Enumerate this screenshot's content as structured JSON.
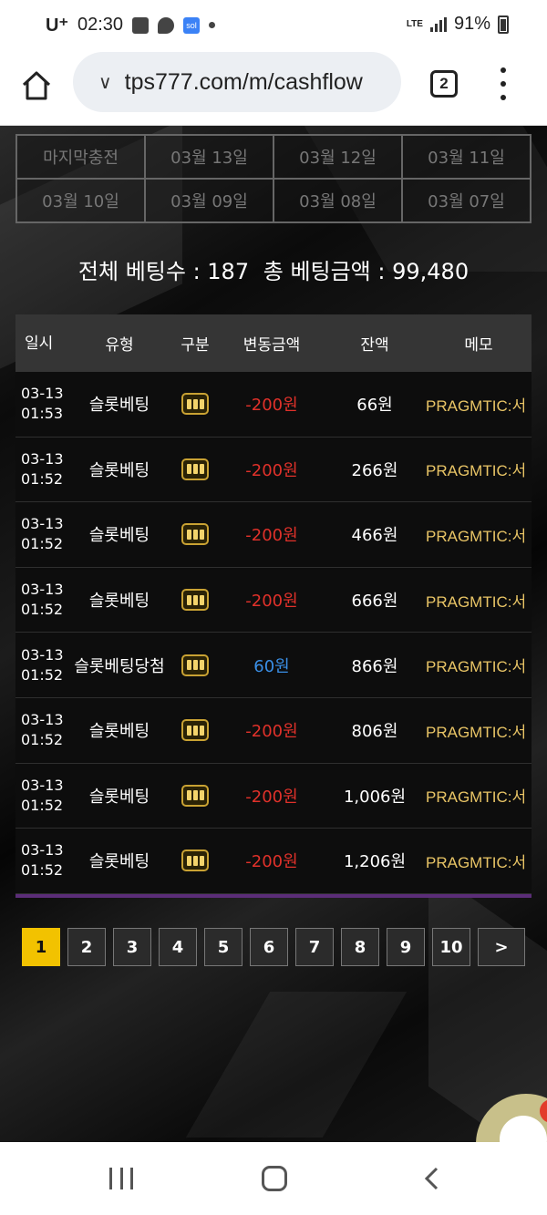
{
  "status_bar": {
    "carrier": "U⁺",
    "time": "02:30",
    "network": "LTE",
    "battery": "91%"
  },
  "browser": {
    "url": "tps777.com/m/cashflow",
    "tab_count": "2",
    "icons": [
      "home-icon",
      "chevron-down-icon",
      "tabs-icon",
      "more-vert-icon"
    ]
  },
  "date_tabs": [
    "마지막충전",
    "03월 13일",
    "03월 12일",
    "03월 11일",
    "03월 10일",
    "03월 09일",
    "03월 08일",
    "03월 07일"
  ],
  "summary": {
    "bet_count_label": "전체 베팅수 : 187",
    "bet_amount_label": "총 베팅금액 : 99,480"
  },
  "table": {
    "headers": [
      "일시",
      "유형",
      "구분",
      "변동금액",
      "잔액",
      "메모"
    ],
    "rows": [
      {
        "date": "03-13",
        "time": "01:53",
        "type": "슬롯베팅",
        "amount": "-200원",
        "balance": "66원",
        "memo": "PRAGMTIC:서"
      },
      {
        "date": "03-13",
        "time": "01:52",
        "type": "슬롯베팅",
        "amount": "-200원",
        "balance": "266원",
        "memo": "PRAGMTIC:서"
      },
      {
        "date": "03-13",
        "time": "01:52",
        "type": "슬롯베팅",
        "amount": "-200원",
        "balance": "466원",
        "memo": "PRAGMTIC:서"
      },
      {
        "date": "03-13",
        "time": "01:52",
        "type": "슬롯베팅",
        "amount": "-200원",
        "balance": "666원",
        "memo": "PRAGMTIC:서"
      },
      {
        "date": "03-13",
        "time": "01:52",
        "type": "슬롯베팅당첨",
        "amount": "60원",
        "balance": "866원",
        "memo": "PRAGMTIC:서"
      },
      {
        "date": "03-13",
        "time": "01:52",
        "type": "슬롯베팅",
        "amount": "-200원",
        "balance": "806원",
        "memo": "PRAGMTIC:서"
      },
      {
        "date": "03-13",
        "time": "01:52",
        "type": "슬롯베팅",
        "amount": "-200원",
        "balance": "1,006원",
        "memo": "PRAGMTIC:서"
      },
      {
        "date": "03-13",
        "time": "01:52",
        "type": "슬롯베팅",
        "amount": "-200원",
        "balance": "1,206원",
        "memo": "PRAGMTIC:서"
      }
    ]
  },
  "pagination": {
    "pages": [
      "1",
      "2",
      "3",
      "4",
      "5",
      "6",
      "7",
      "8",
      "9",
      "10"
    ],
    "current": "1",
    "next": ">"
  },
  "colors": {
    "negative": "#e0312a",
    "positive": "#3a8fe6",
    "memo": "#e9c566",
    "active_page": "#f2c200",
    "table_bottom": "#5b2d78"
  }
}
